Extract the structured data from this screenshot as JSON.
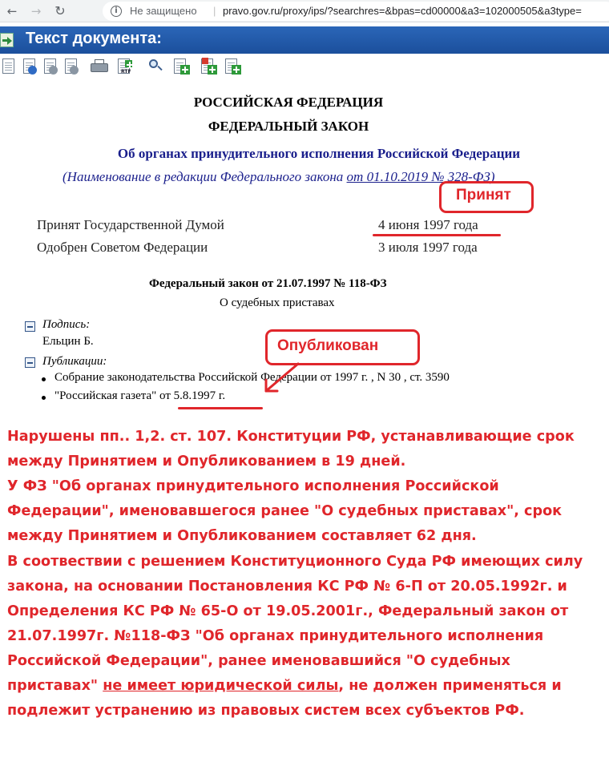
{
  "browser": {
    "back_icon": "arrow-left-icon",
    "forward_icon": "arrow-right-icon",
    "reload_icon": "reload-icon",
    "security_label": "Не защищено",
    "url": "pravo.gov.ru/proxy/ips/?searchres=&bpas=cd00000&a3=102000505&a3type="
  },
  "header": {
    "title": "Текст документа:",
    "icon": "document-arrow-icon"
  },
  "toolbar": {
    "buttons": [
      "copy-doc-icon",
      "info-doc-icon",
      "link-doc-icon",
      "links-doc-icon",
      "printer-icon",
      "rtf-export-icon",
      "search-doc-icon",
      "add-doc-icon",
      "bookmark-add-icon",
      "tree-add-icon"
    ],
    "rtf_label": "RTF"
  },
  "document": {
    "country": "РОССИЙСКАЯ ФЕДЕРАЦИЯ",
    "type": "ФЕДЕРАЛЬНЫЙ ЗАКОН",
    "law_name": "Об органах принудительного исполнения Российской Федерации",
    "note_prefix": "(Наименование в редакции Федерального закона ",
    "note_link": "от 01.10.2019 № 328-ФЗ",
    "note_suffix": ")",
    "adopted_label": "Принят Государственной Думой",
    "adopted_date": "4 июня 1997 года",
    "approved_label": "Одобрен Советом Федерации",
    "approved_date": "3 июля 1997 года",
    "fz_heading": "Федеральный закон от 21.07.1997 № 118-ФЗ",
    "fz_subtitle": "О судебных приставах",
    "signature_label": "Подпись:",
    "signature_value": "Ельцин Б.",
    "publications_label": "Публикации:",
    "publications": [
      "Собрание законодательства Российской Федерации от 1997 г. , N 30 , ст. 3590",
      "\"Российская газета\" от 5.8.1997 г."
    ]
  },
  "annotations": {
    "accepted": "Принят",
    "published": "Опубликован",
    "accent_color": "#e0262b",
    "paragraph1": [
      "Нарушены пп.. 1,2. ст. 107. Конституции РФ, устанавливающие срок",
      "между Принятием и Опубликованием в 19 дней.",
      "У ФЗ \"Об органах принудительного исполнения Российской",
      "Федерации\", именовавшегося ранее \"О судебных приставах\", срок",
      "между Принятием и Опубликованием составляет 62 дня."
    ],
    "paragraph2": [
      "В соотвествии с решением Конституционного Суда РФ имеющих силу",
      "закона, на основании Постановления КС РФ № 6-П от 20.05.1992г. и",
      "Определения КС РФ № 65-О от 19.05.2001г., Федеральный закон от",
      "21.07.1997г. №118-ФЗ \"Об органах принудительного исполнения",
      "Российской Федерации\", ранее именовавшийся \"О судебных"
    ],
    "p2_line6_pre": "приставах\" ",
    "p2_line6_under": "не имеет юридической силы",
    "p2_line6_post": ", не должен применяться и",
    "p2_line7": "подлежит устранению из правовых систем всех субъектов РФ."
  }
}
